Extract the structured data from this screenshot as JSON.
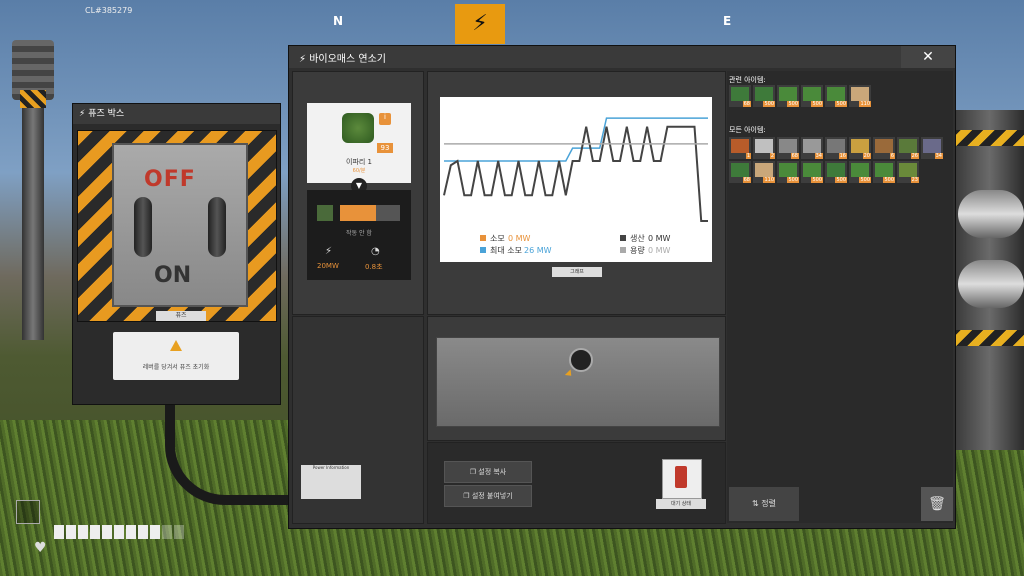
{
  "hud": {
    "build_id": "CL#385279",
    "compass_n": "N",
    "compass_e": "E",
    "health_cells_total": 11,
    "health_cells_filled": 9
  },
  "fuse_box": {
    "title": "퓨즈 박스",
    "off_label": "OFF",
    "on_label": "ON",
    "label": "퓨즈",
    "notice": "레버를 당겨서 퓨즈 초기화"
  },
  "burner": {
    "title": "바이오매스 연소기",
    "close_icon": "close-icon",
    "slot": {
      "item_name": "이파리 1",
      "rate": "60/분",
      "count": "93",
      "status": "작동 안 함",
      "progress": 0.6,
      "power": "20MW",
      "time": "0.8초"
    },
    "power_plate": "Power Information"
  },
  "chart": {
    "button": "그래프",
    "legend": {
      "consumption": "소모",
      "consumption_val": "0 MW",
      "max_consumption": "최대 소모",
      "max_consumption_val": "26 MW",
      "production": "생산",
      "production_val": "0 MW",
      "capacity": "용량",
      "capacity_val": "0 MW"
    }
  },
  "chart_data": {
    "type": "line",
    "title": "",
    "xlabel": "",
    "ylabel": "",
    "series": [
      {
        "name": "최대 소모",
        "color": "#4aa3d8",
        "values": [
          14,
          14,
          14,
          14,
          14,
          14,
          14,
          14,
          14,
          14,
          14,
          14,
          14,
          14,
          14,
          14,
          14,
          14,
          14,
          17,
          17,
          17,
          17,
          17,
          24,
          24,
          24,
          24,
          24,
          24,
          24,
          24,
          24,
          24,
          24,
          24,
          24,
          24,
          24,
          24
        ]
      },
      {
        "name": "생산",
        "color": "#444444",
        "values": [
          6,
          13,
          14,
          6,
          6,
          14,
          6,
          6,
          14,
          6,
          6,
          14,
          6,
          6,
          14,
          6,
          6,
          14,
          6,
          14,
          14,
          22,
          14,
          14,
          22,
          14,
          14,
          22,
          14,
          14,
          22,
          14,
          14,
          22,
          22,
          22,
          22,
          22,
          0,
          0
        ]
      },
      {
        "name": "용량",
        "color": "#aaaaaa",
        "values": [
          18,
          18,
          18,
          18,
          18,
          18,
          18,
          18,
          18,
          18,
          18,
          18,
          18,
          18,
          18,
          18,
          18,
          18,
          18,
          18,
          18,
          18,
          18,
          18,
          18,
          18,
          18,
          18,
          18,
          18,
          18,
          18,
          18,
          18,
          18,
          18,
          18,
          18,
          18,
          18
        ]
      }
    ]
  },
  "controls": {
    "copy_label": "설정 복사",
    "paste_label": "설정 붙여넣기",
    "standby_label": "대기 상태"
  },
  "inventory": {
    "related_title": "관련 아이템:",
    "all_title": "모든 아이템:",
    "sort_label": "정렬",
    "related": [
      {
        "count": "68",
        "color": "#3e7a3a"
      },
      {
        "count": "500",
        "color": "#3e7a3a"
      },
      {
        "count": "500",
        "color": "#4a8a3a"
      },
      {
        "count": "500",
        "color": "#4a8a3a"
      },
      {
        "count": "500",
        "color": "#4a8a3a"
      },
      {
        "count": "110",
        "color": "#c9a77a"
      }
    ],
    "all": [
      {
        "count": "1",
        "color": "#b85c2a"
      },
      {
        "count": "2",
        "color": "#c0c0c0"
      },
      {
        "count": "68",
        "color": "#888888"
      },
      {
        "count": "34",
        "color": "#999999"
      },
      {
        "count": "16",
        "color": "#777777"
      },
      {
        "count": "20",
        "color": "#c9a040"
      },
      {
        "count": "6",
        "color": "#9a6a3a"
      },
      {
        "count": "26",
        "color": "#5a7a3a"
      },
      {
        "count": "34",
        "color": "#6a6a8a"
      },
      {
        "count": "68",
        "color": "#3e7a3a"
      },
      {
        "count": "110",
        "color": "#c9a77a"
      },
      {
        "count": "500",
        "color": "#4a8a3a"
      },
      {
        "count": "500",
        "color": "#4a8a3a"
      },
      {
        "count": "500",
        "color": "#3e7a3a"
      },
      {
        "count": "500",
        "color": "#4a8a3a"
      },
      {
        "count": "500",
        "color": "#4a8a3a"
      },
      {
        "count": "23",
        "color": "#6a8a3a"
      }
    ]
  }
}
